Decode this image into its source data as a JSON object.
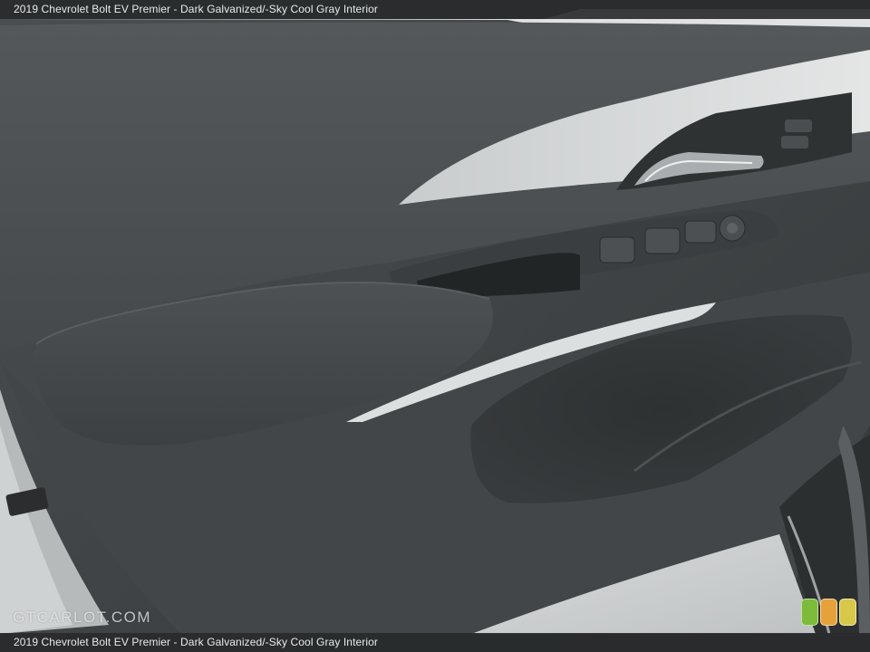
{
  "caption": {
    "top": "2019 Chevrolet Bolt EV Premier - Dark Galvanized/-Sky Cool Gray Interior",
    "bottom": "2019 Chevrolet Bolt EV Premier - Dark Galvanized/-Sky Cool Gray Interior"
  },
  "watermark": {
    "text": "GTCARLOT.COM"
  },
  "logo": {
    "colors": [
      "#7dbb3a",
      "#e6a23a",
      "#d9c74a"
    ]
  }
}
